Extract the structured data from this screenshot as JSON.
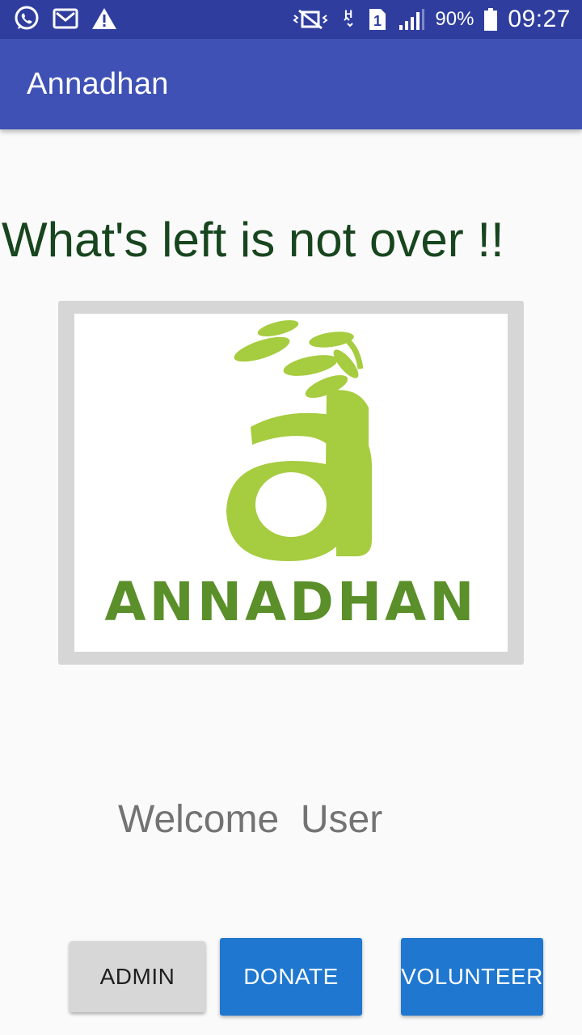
{
  "status_bar": {
    "battery_percent": "90%",
    "time": "09:27",
    "sim_slot": "1",
    "network_type": "H",
    "icons_left": [
      "whatsapp-icon",
      "gmail-icon",
      "warning-icon"
    ],
    "icons_right": [
      "vibrate-icon",
      "data-arrows-icon",
      "sim-icon",
      "signal-icon",
      "battery-icon"
    ]
  },
  "app_bar": {
    "title": "Annadhan"
  },
  "main": {
    "tagline": "What's left is not over !!",
    "logo": {
      "wordmark": "ANNADHAN",
      "colors": {
        "leaf": "#9bc53d",
        "letter": "#a4cc3a",
        "wordmark": "#5a8f29"
      }
    },
    "welcome_text": "Welcome  User"
  },
  "buttons": {
    "admin": "ADMIN",
    "donate": "DONATE",
    "volunteer": "VOLUNTEER"
  },
  "colors": {
    "status_bar": "#2f3e9e",
    "app_bar": "#3f51b5",
    "tagline": "#17451e",
    "primary_button": "#1f77d0",
    "secondary_button": "#d7d7d7"
  }
}
